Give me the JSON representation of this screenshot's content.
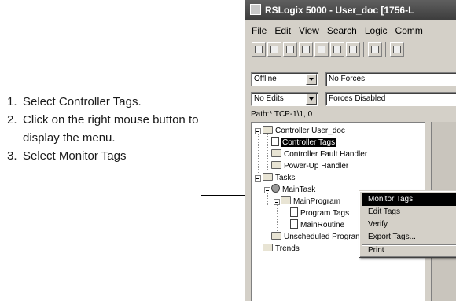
{
  "instructions": {
    "steps": [
      {
        "num": "1.",
        "text": "Select Controller Tags."
      },
      {
        "num": "2.",
        "text": "Click on the right mouse button to display the menu."
      },
      {
        "num": "3.",
        "text": "Select Monitor Tags"
      }
    ]
  },
  "window": {
    "title": "RSLogix 5000 - User_doc [1756-L",
    "menu": [
      "File",
      "Edit",
      "View",
      "Search",
      "Logic",
      "Comm"
    ],
    "mode_combo": "Offline",
    "forces_field": "No Forces",
    "edits_combo": "No Edits",
    "forces_status": "Forces Disabled",
    "path": "Path:* TCP-1\\1, 0"
  },
  "tree": {
    "nodes": [
      {
        "label": "Controller User_doc",
        "icon": "folder-icon"
      },
      {
        "label": "Controller Tags",
        "icon": "tags-icon",
        "selected": true
      },
      {
        "label": "Controller Fault Handler",
        "icon": "folder-icon"
      },
      {
        "label": "Power-Up Handler",
        "icon": "folder-icon"
      },
      {
        "label": "Tasks",
        "icon": "folder-icon"
      },
      {
        "label": "MainTask",
        "icon": "task-icon"
      },
      {
        "label": "MainProgram",
        "icon": "program-icon"
      },
      {
        "label": "Program Tags",
        "icon": "tags-icon"
      },
      {
        "label": "MainRoutine",
        "icon": "routine-icon"
      },
      {
        "label": "Unscheduled Programs",
        "icon": "folder-icon"
      },
      {
        "label": "Trends",
        "icon": "folder-icon"
      }
    ]
  },
  "context_menu": {
    "items": [
      "Monitor Tags",
      "Edit Tags",
      "Verify",
      "Export Tags...",
      "Print"
    ],
    "highlighted": "Monitor Tags"
  }
}
